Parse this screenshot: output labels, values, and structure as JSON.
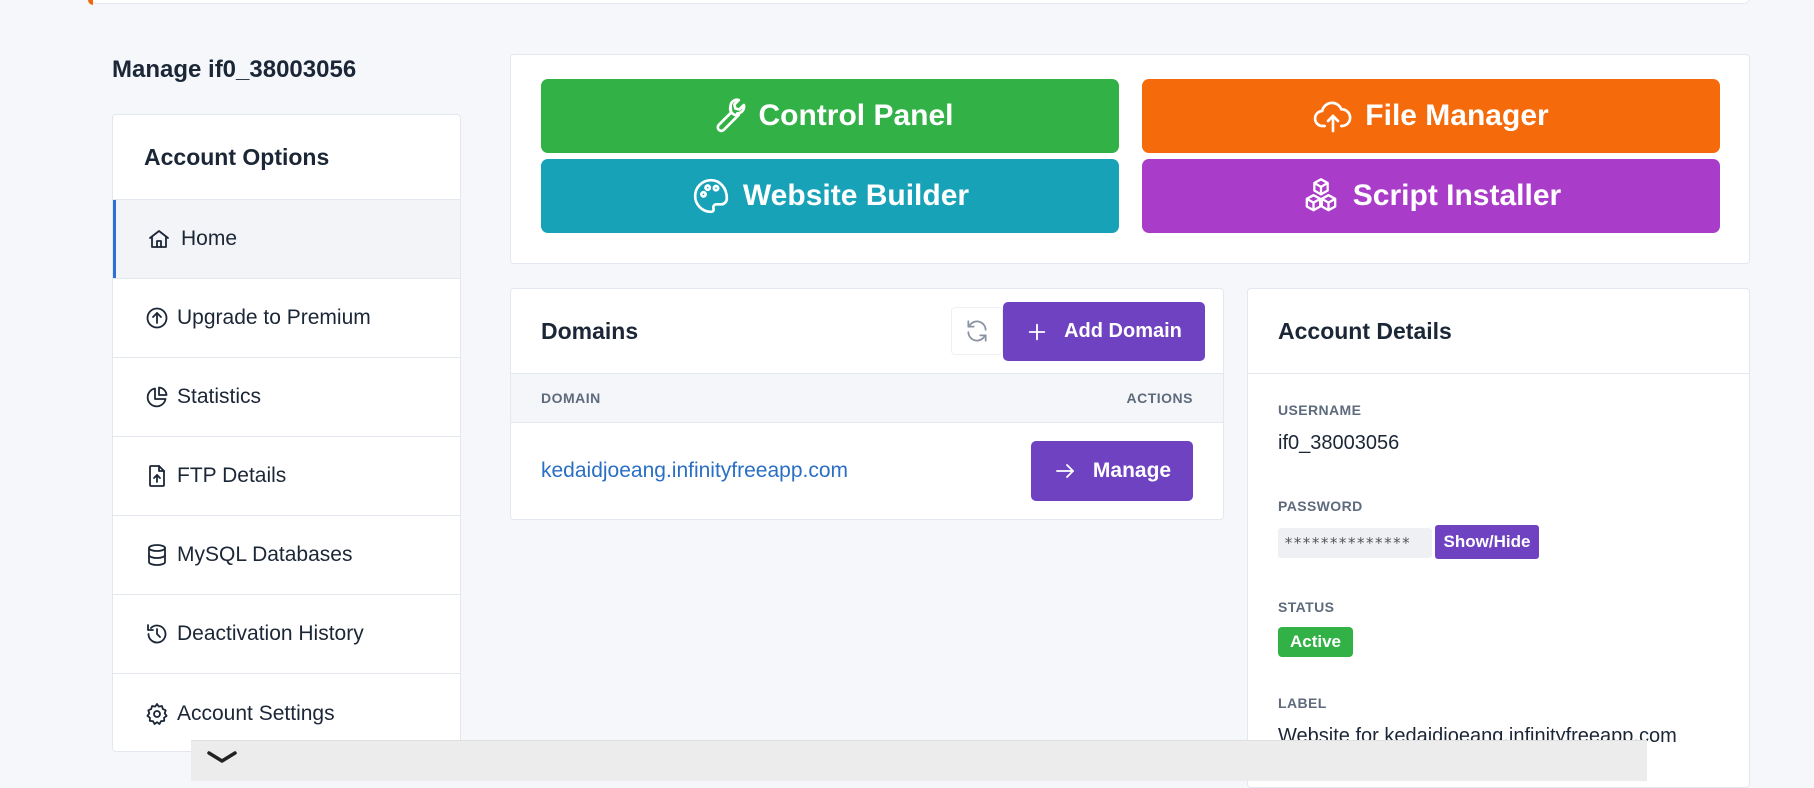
{
  "page": {
    "title": "Manage if0_38003056"
  },
  "sidebar": {
    "title": "Account Options",
    "items": [
      {
        "label": "Home",
        "icon": "home-icon",
        "active": true
      },
      {
        "label": "Upgrade to Premium",
        "icon": "arrow-up-circle-icon"
      },
      {
        "label": "Statistics",
        "icon": "pie-chart-icon"
      },
      {
        "label": "FTP Details",
        "icon": "file-upload-icon"
      },
      {
        "label": "MySQL Databases",
        "icon": "database-icon"
      },
      {
        "label": "Deactivation History",
        "icon": "history-icon"
      },
      {
        "label": "Account Settings",
        "icon": "gear-icon"
      }
    ]
  },
  "quick_actions": {
    "control_panel": "Control Panel",
    "file_manager": "File Manager",
    "website_builder": "Website Builder",
    "script_installer": "Script Installer"
  },
  "domains": {
    "title": "Domains",
    "add_label": "Add Domain",
    "col_domain": "DOMAIN",
    "col_actions": "ACTIONS",
    "rows": [
      {
        "domain": "kedaidjoeang.infinityfreeapp.com",
        "action": "Manage"
      }
    ]
  },
  "account_details": {
    "title": "Account Details",
    "username_label": "USERNAME",
    "username": "if0_38003056",
    "password_label": "PASSWORD",
    "password_masked": "**************",
    "show_hide": "Show/Hide",
    "status_label": "STATUS",
    "status": "Active",
    "label_label": "LABEL",
    "label": "Website for kedaidjoeang.infinityfreeapp.com"
  },
  "colors": {
    "accent": "#6f42c1",
    "control_panel": "#32b246",
    "file_manager": "#f56a0b",
    "website_builder": "#18a2b8",
    "script_installer": "#a93cc8",
    "status_active": "#32b246",
    "link": "#2a6fc4"
  }
}
